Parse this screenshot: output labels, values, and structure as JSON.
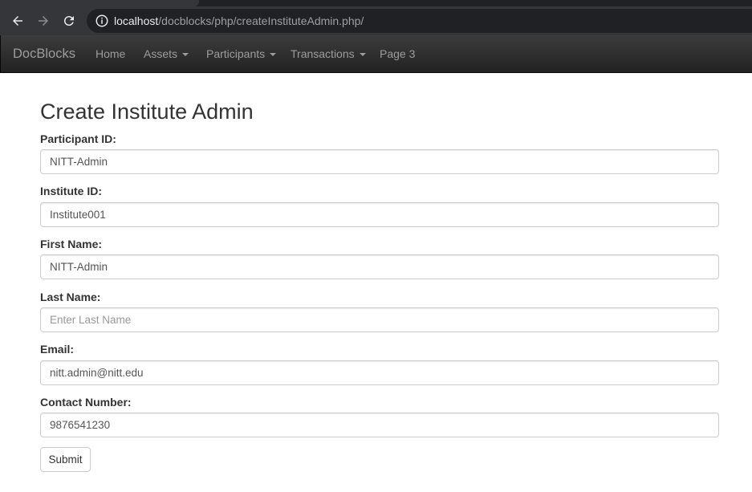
{
  "browser": {
    "url_host": "localhost",
    "url_path": "/docblocks/php/createInstituteAdmin.php/"
  },
  "navbar": {
    "brand": "DocBlocks",
    "items": [
      {
        "label": "Home"
      },
      {
        "label": "Assets"
      },
      {
        "label": "Participants"
      },
      {
        "label": "Transactions"
      },
      {
        "label": "Page 3"
      }
    ]
  },
  "page": {
    "title": "Create Institute Admin"
  },
  "form": {
    "participant_id": {
      "label": "Participant ID:",
      "value": "NITT-Admin"
    },
    "institute_id": {
      "label": "Institute ID:",
      "value": "Institute001"
    },
    "first_name": {
      "label": "First Name:",
      "value": "NITT-Admin"
    },
    "last_name": {
      "label": "Last Name:",
      "value": "",
      "placeholder": "Enter Last Name"
    },
    "email": {
      "label": "Email:",
      "value": "nitt.admin@nitt.edu"
    },
    "contact_number": {
      "label": "Contact Number:",
      "value": "9876541230"
    },
    "submit_label": "Submit"
  }
}
